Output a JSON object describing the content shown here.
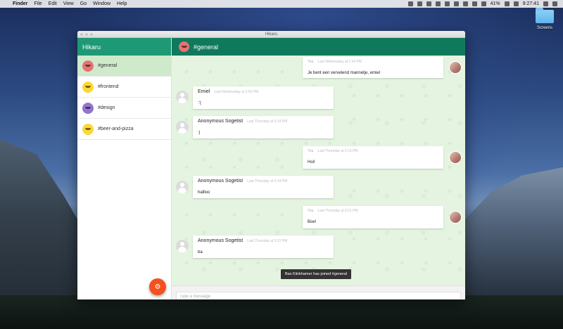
{
  "menubar": {
    "items": [
      "Finder",
      "File",
      "Edit",
      "View",
      "Go",
      "Window",
      "Help"
    ],
    "battery": "41%",
    "clock": "9:27:41"
  },
  "desktop": {
    "folder_label": "Screens"
  },
  "window": {
    "title": "Hikaru"
  },
  "sidebar": {
    "title": "Hikaru",
    "channels": [
      {
        "label": "#general",
        "avatar_color": "#e57373"
      },
      {
        "label": "#frontend",
        "avatar_color": "#fdd835"
      },
      {
        "label": "#design",
        "avatar_color": "#9575cd"
      },
      {
        "label": "#beer-and-pizza",
        "avatar_color": "#fdd835"
      }
    ]
  },
  "main": {
    "channel": "#general",
    "messages": [
      {
        "author": "You",
        "time": "Last Wednesday at 1:04 PM",
        "text": "Je bent een vervelend mannetje, emiel",
        "self": true
      },
      {
        "author": "Emiel",
        "time": "Last Wednesday at 2:00 PM",
        "text": ":'(",
        "self": false
      },
      {
        "author": "Anonymous Sogetist",
        "time": "Last Thursday at 5:19 PM",
        "text": ":|",
        "self": false
      },
      {
        "author": "You",
        "time": "Last Thursday at 5:19 PM",
        "text": "Hoi!",
        "self": true
      },
      {
        "author": "Anonymous Sogetist",
        "time": "Last Thursday at 5:19 PM",
        "text": "hallloo",
        "self": false
      },
      {
        "author": "You",
        "time": "Last Thursday at 5:21 PM",
        "text": "Boe!",
        "self": true
      },
      {
        "author": "Anonymous Sogetist",
        "time": "Last Thursday at 5:22 PM",
        "text": "ba",
        "self": false
      }
    ],
    "toast": "Bas Klinkhamer has joined #general",
    "composer_placeholder": "Type a message",
    "settings_icon": "gear-icon"
  },
  "colors": {
    "sidebar_header": "#1e9975",
    "main_header": "#0f7a5b",
    "active_channel": "#cfeacb",
    "chat_background": "#e4f4e0",
    "fab": "#f4511e"
  }
}
